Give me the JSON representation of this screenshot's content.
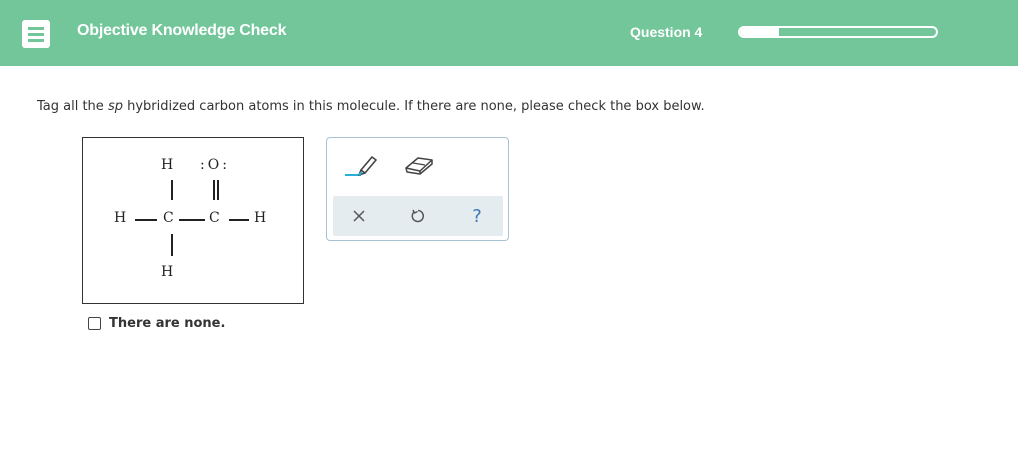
{
  "header": {
    "title": "Objective Knowledge Check",
    "question_label": "Question 4",
    "progress_fraction": 0.2,
    "bar_color": "#72c69a"
  },
  "prompt": {
    "before": "Tag all the ",
    "emphasis": "sp",
    "after": " hybridized carbon atoms in this molecule. If there are none, please check the box below."
  },
  "molecule": {
    "atoms": {
      "h_top": "H",
      "o_label": ":O:",
      "h_left": "H",
      "c_left": "C",
      "c_right": "C",
      "h_right": "H",
      "h_bottom": "H"
    }
  },
  "toolbox": {
    "tools": [
      "pencil-icon",
      "eraser-icon"
    ],
    "actions": {
      "clear": "×",
      "undo": "↺",
      "help": "?"
    }
  },
  "none_option": {
    "label": "There are none.",
    "checked": false
  }
}
